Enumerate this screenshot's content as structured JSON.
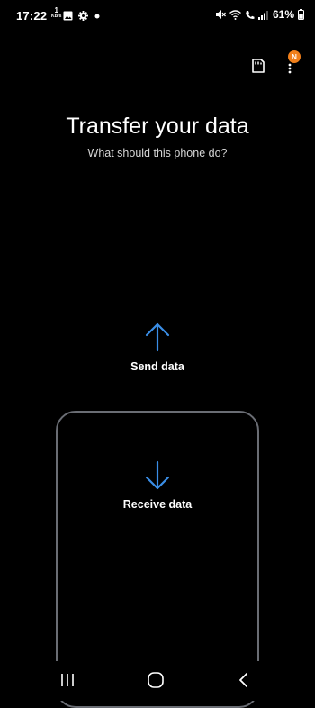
{
  "status_bar": {
    "time": "17:22",
    "net_speed_value": "1",
    "net_speed_unit": "KB/s",
    "battery": "61%",
    "icons_left": [
      "image-icon",
      "gear-icon",
      "dot-icon"
    ],
    "icons_right": [
      "mute-icon",
      "wifi-icon",
      "call-signal-icon",
      "signal-icon",
      "battery-icon"
    ]
  },
  "header": {
    "badge": "N",
    "sd_card_icon": "sd-card-icon",
    "menu_icon": "more-vertical-icon"
  },
  "main": {
    "title": "Transfer your data",
    "subtitle": "What should this phone do?",
    "send_label": "Send data",
    "receive_label": "Receive data"
  },
  "colors": {
    "accent": "#3a8ee6",
    "background": "#000000",
    "panel_border": "#6a6d74",
    "badge": "#f07f1a"
  }
}
